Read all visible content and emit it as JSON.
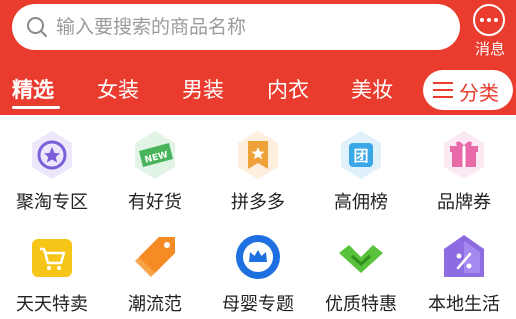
{
  "search": {
    "placeholder": "输入要搜索的商品名称"
  },
  "message": {
    "label": "消息",
    "icon": "chat-bubble-icon"
  },
  "tabs": [
    {
      "label": "精选",
      "active": true
    },
    {
      "label": "女装",
      "active": false
    },
    {
      "label": "男装",
      "active": false
    },
    {
      "label": "内衣",
      "active": false
    },
    {
      "label": "美妆",
      "active": false
    }
  ],
  "category_button": {
    "label": "分类",
    "icon": "menu-lines-icon"
  },
  "grid": [
    {
      "label": "聚淘专区",
      "icon": "star-badge-icon"
    },
    {
      "label": "有好货",
      "icon": "new-tag-icon"
    },
    {
      "label": "拼多多",
      "icon": "star-bookmark-icon"
    },
    {
      "label": "高佣榜",
      "icon": "group-rank-icon"
    },
    {
      "label": "品牌券",
      "icon": "gift-box-icon"
    },
    {
      "label": "天天特卖",
      "icon": "shopping-cart-icon"
    },
    {
      "label": "潮流范",
      "icon": "price-tag-icon"
    },
    {
      "label": "母婴专题",
      "icon": "crown-icon"
    },
    {
      "label": "优质特惠",
      "icon": "check-badge-icon"
    },
    {
      "label": "本地生活",
      "icon": "percent-house-icon"
    }
  ],
  "colors": {
    "brand": "#e93b2e",
    "text": "#222222",
    "placeholder": "#9b9b9b"
  }
}
